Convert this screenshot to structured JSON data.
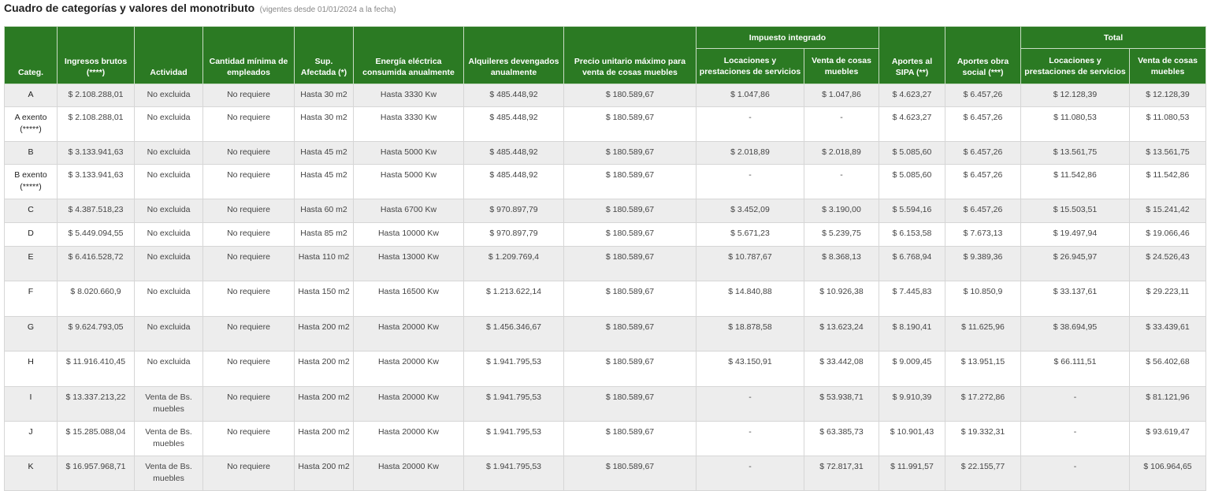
{
  "title": {
    "main": "Cuadro de categorías y valores del monotributo",
    "sub": "(vigentes desde 01/01/2024 a la fecha)"
  },
  "headers": {
    "categ": "Categ.",
    "ingresos": "Ingresos brutos (****)",
    "actividad": "Actividad",
    "empleados": "Cantidad mínima de empleados",
    "sup": "Sup. Afectada (*)",
    "energia": "Energía eléctrica consumida anualmente",
    "alquileres": "Alquileres devengados anualmente",
    "precio": "Precio unitario máximo para venta de cosas muebles",
    "impuesto_group": "Impuesto integrado",
    "imp_locaciones": "Locaciones y prestaciones de servicios",
    "imp_venta": "Venta de cosas muebles",
    "sipa": "Aportes al SIPA (**)",
    "obra": "Aportes obra social (***)",
    "total_group": "Total",
    "tot_locaciones": "Locaciones y prestaciones de servicios",
    "tot_venta": "Venta de cosas muebles"
  },
  "rows": [
    {
      "categ": "A",
      "ingresos": "$ 2.108.288,01",
      "actividad": "No excluida",
      "empleados": "No requiere",
      "sup": "Hasta 30 m2",
      "energia": "Hasta 3330 Kw",
      "alquileres": "$ 485.448,92",
      "precio": "$ 180.589,67",
      "imp_loc": "$ 1.047,86",
      "imp_venta": "$ 1.047,86",
      "sipa": "$ 4.623,27",
      "obra": "$ 6.457,26",
      "tot_loc": "$ 12.128,39",
      "tot_venta": "$ 12.128,39"
    },
    {
      "categ": "A exento (*****)",
      "ingresos": "$ 2.108.288,01",
      "actividad": "No excluida",
      "empleados": "No requiere",
      "sup": "Hasta 30 m2",
      "energia": "Hasta 3330 Kw",
      "alquileres": "$ 485.448,92",
      "precio": "$ 180.589,67",
      "imp_loc": "-",
      "imp_venta": "-",
      "sipa": "$ 4.623,27",
      "obra": "$ 6.457,26",
      "tot_loc": "$ 11.080,53",
      "tot_venta": "$ 11.080,53"
    },
    {
      "categ": "B",
      "ingresos": "$ 3.133.941,63",
      "actividad": "No excluida",
      "empleados": "No requiere",
      "sup": "Hasta 45 m2",
      "energia": "Hasta 5000 Kw",
      "alquileres": "$ 485.448,92",
      "precio": "$ 180.589,67",
      "imp_loc": "$ 2.018,89",
      "imp_venta": "$ 2.018,89",
      "sipa": "$ 5.085,60",
      "obra": "$ 6.457,26",
      "tot_loc": "$ 13.561,75",
      "tot_venta": "$ 13.561,75"
    },
    {
      "categ": "B exento (*****)",
      "ingresos": "$ 3.133.941,63",
      "actividad": "No excluida",
      "empleados": "No requiere",
      "sup": "Hasta 45 m2",
      "energia": "Hasta 5000 Kw",
      "alquileres": "$ 485.448,92",
      "precio": "$ 180.589,67",
      "imp_loc": "-",
      "imp_venta": "-",
      "sipa": "$ 5.085,60",
      "obra": "$ 6.457,26",
      "tot_loc": "$ 11.542,86",
      "tot_venta": "$ 11.542,86"
    },
    {
      "categ": "C",
      "ingresos": "$ 4.387.518,23",
      "actividad": "No excluida",
      "empleados": "No requiere",
      "sup": "Hasta 60 m2",
      "energia": "Hasta 6700 Kw",
      "alquileres": "$ 970.897,79",
      "precio": "$ 180.589,67",
      "imp_loc": "$ 3.452,09",
      "imp_venta": "$ 3.190,00",
      "sipa": "$ 5.594,16",
      "obra": "$ 6.457,26",
      "tot_loc": "$ 15.503,51",
      "tot_venta": "$ 15.241,42"
    },
    {
      "categ": "D",
      "ingresos": "$ 5.449.094,55",
      "actividad": "No excluida",
      "empleados": "No requiere",
      "sup": "Hasta 85 m2",
      "energia": "Hasta 10000 Kw",
      "alquileres": "$ 970.897,79",
      "precio": "$ 180.589,67",
      "imp_loc": "$ 5.671,23",
      "imp_venta": "$ 5.239,75",
      "sipa": "$ 6.153,58",
      "obra": "$ 7.673,13",
      "tot_loc": "$ 19.497,94",
      "tot_venta": "$ 19.066,46"
    },
    {
      "categ": "E",
      "ingresos": "$ 6.416.528,72",
      "actividad": "No excluida",
      "empleados": "No requiere",
      "sup": "Hasta 110 m2",
      "energia": "Hasta 13000 Kw",
      "alquileres": "$ 1.209.769,4",
      "precio": "$ 180.589,67",
      "imp_loc": "$ 10.787,67",
      "imp_venta": "$ 8.368,13",
      "sipa": "$ 6.768,94",
      "obra": "$ 9.389,36",
      "tot_loc": "$ 26.945,97",
      "tot_venta": "$ 24.526,43"
    },
    {
      "categ": "F",
      "ingresos": "$ 8.020.660,9",
      "actividad": "No excluida",
      "empleados": "No requiere",
      "sup": "Hasta 150 m2",
      "energia": "Hasta 16500 Kw",
      "alquileres": "$ 1.213.622,14",
      "precio": "$ 180.589,67",
      "imp_loc": "$ 14.840,88",
      "imp_venta": "$ 10.926,38",
      "sipa": "$ 7.445,83",
      "obra": "$ 10.850,9",
      "tot_loc": "$ 33.137,61",
      "tot_venta": "$ 29.223,11"
    },
    {
      "categ": "G",
      "ingresos": "$ 9.624.793,05",
      "actividad": "No excluida",
      "empleados": "No requiere",
      "sup": "Hasta 200 m2",
      "energia": "Hasta 20000 Kw",
      "alquileres": "$ 1.456.346,67",
      "precio": "$ 180.589,67",
      "imp_loc": "$ 18.878,58",
      "imp_venta": "$ 13.623,24",
      "sipa": "$ 8.190,41",
      "obra": "$ 11.625,96",
      "tot_loc": "$ 38.694,95",
      "tot_venta": "$ 33.439,61"
    },
    {
      "categ": "H",
      "ingresos": "$ 11.916.410,45",
      "actividad": "No excluida",
      "empleados": "No requiere",
      "sup": "Hasta 200 m2",
      "energia": "Hasta 20000 Kw",
      "alquileres": "$ 1.941.795,53",
      "precio": "$ 180.589,67",
      "imp_loc": "$ 43.150,91",
      "imp_venta": "$ 33.442,08",
      "sipa": "$ 9.009,45",
      "obra": "$ 13.951,15",
      "tot_loc": "$ 66.111,51",
      "tot_venta": "$ 56.402,68"
    },
    {
      "categ": "I",
      "ingresos": "$ 13.337.213,22",
      "actividad": "Venta de Bs. muebles",
      "empleados": "No requiere",
      "sup": "Hasta 200 m2",
      "energia": "Hasta 20000 Kw",
      "alquileres": "$ 1.941.795,53",
      "precio": "$ 180.589,67",
      "imp_loc": "-",
      "imp_venta": "$ 53.938,71",
      "sipa": "$ 9.910,39",
      "obra": "$ 17.272,86",
      "tot_loc": "-",
      "tot_venta": "$ 81.121,96"
    },
    {
      "categ": "J",
      "ingresos": "$ 15.285.088,04",
      "actividad": "Venta de Bs. muebles",
      "empleados": "No requiere",
      "sup": "Hasta 200 m2",
      "energia": "Hasta 20000 Kw",
      "alquileres": "$ 1.941.795,53",
      "precio": "$ 180.589,67",
      "imp_loc": "-",
      "imp_venta": "$ 63.385,73",
      "sipa": "$ 10.901,43",
      "obra": "$ 19.332,31",
      "tot_loc": "-",
      "tot_venta": "$ 93.619,47"
    },
    {
      "categ": "K",
      "ingresos": "$ 16.957.968,71",
      "actividad": "Venta de Bs. muebles",
      "empleados": "No requiere",
      "sup": "Hasta 200 m2",
      "energia": "Hasta 20000 Kw",
      "alquileres": "$ 1.941.795,53",
      "precio": "$ 180.589,67",
      "imp_loc": "-",
      "imp_venta": "$ 72.817,31",
      "sipa": "$ 11.991,57",
      "obra": "$ 22.155,77",
      "tot_loc": "-",
      "tot_venta": "$ 106.964,65"
    }
  ]
}
